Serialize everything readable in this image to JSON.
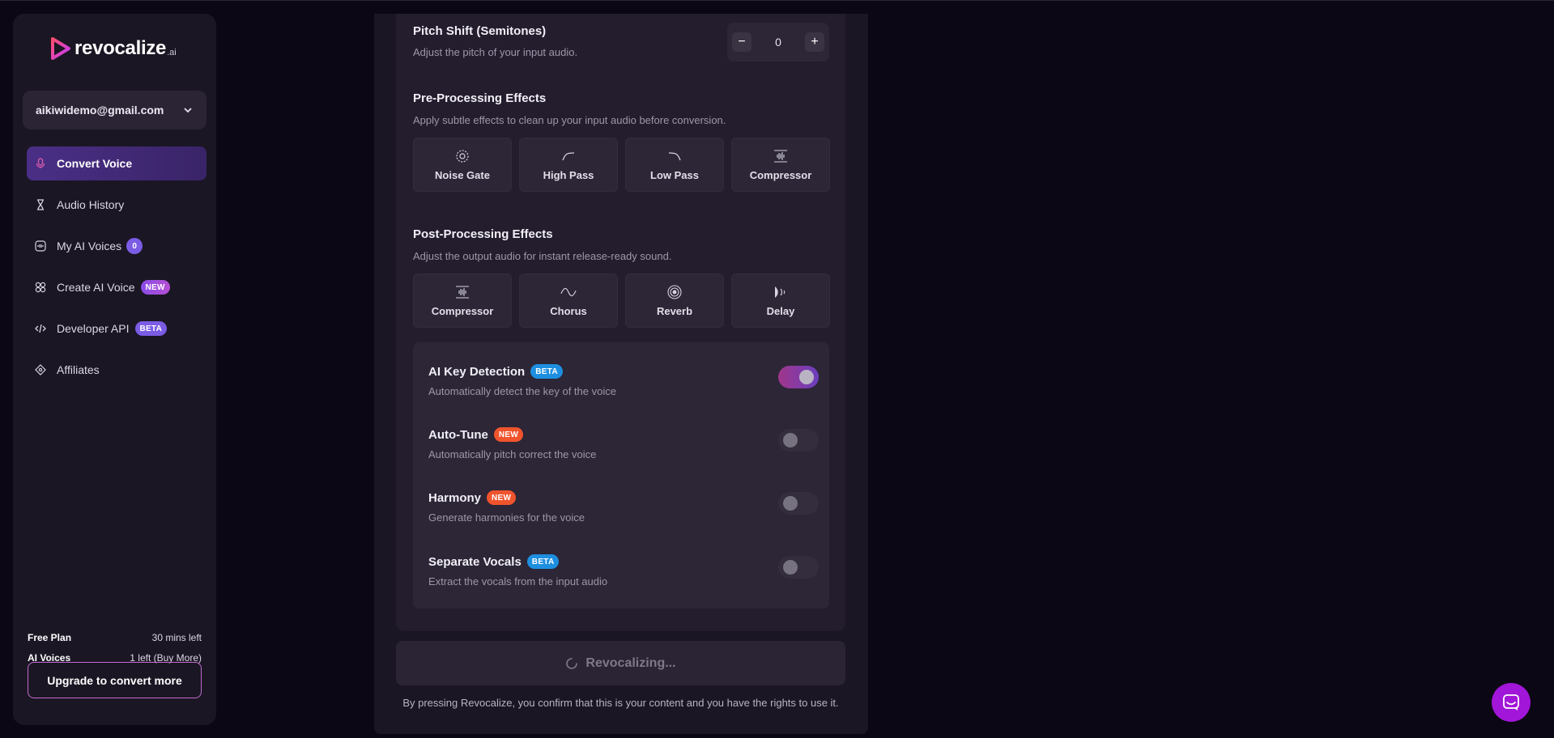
{
  "sidebar": {
    "brand": "revocalize",
    "brand_suffix": ".ai",
    "account_email": "aikiwidemo@gmail.com",
    "nav": [
      {
        "label": "Convert Voice",
        "icon": "microphone-icon",
        "active": true
      },
      {
        "label": "Audio History",
        "icon": "hourglass-icon"
      },
      {
        "label": "My AI Voices",
        "icon": "voices-icon",
        "count": "0"
      },
      {
        "label": "Create AI Voice",
        "icon": "create-voice-icon",
        "badge": "NEW"
      },
      {
        "label": "Developer API",
        "icon": "code-icon",
        "badge": "BETA"
      },
      {
        "label": "Affiliates",
        "icon": "affiliates-icon"
      }
    ],
    "plan": {
      "free_plan_label": "Free Plan",
      "free_plan_value": "30 mins left",
      "ai_voices_label": "AI Voices",
      "ai_voices_value": "1 left (Buy More)"
    },
    "upgrade_label": "Upgrade to convert more"
  },
  "pitch": {
    "title": "Pitch Shift (Semitones)",
    "subtitle": "Adjust the pitch of your input audio.",
    "value": "0",
    "minus": "−",
    "plus": "+"
  },
  "pre": {
    "title": "Pre-Processing Effects",
    "subtitle": "Apply subtle effects to clean up your input audio before conversion.",
    "effects": [
      "Noise Gate",
      "High Pass",
      "Low Pass",
      "Compressor"
    ]
  },
  "post": {
    "title": "Post-Processing Effects",
    "subtitle": "Adjust the output audio for instant release-ready sound.",
    "effects": [
      "Compressor",
      "Chorus",
      "Reverb",
      "Delay"
    ]
  },
  "toggles": [
    {
      "title": "AI Key Detection",
      "badge": "BETA",
      "desc": "Automatically detect the key of the voice",
      "on": true
    },
    {
      "title": "Auto-Tune",
      "badge": "NEW",
      "desc": "Automatically pitch correct the voice",
      "on": false
    },
    {
      "title": "Harmony",
      "badge": "NEW",
      "desc": "Generate harmonies for the voice",
      "on": false
    },
    {
      "title": "Separate Vocals",
      "badge": "BETA",
      "desc": "Extract the vocals from the input audio",
      "on": false
    }
  ],
  "convert_label": "Revocalizing...",
  "disclaimer": "By pressing Revocalize, you confirm that this is your content and you have the rights to use it.",
  "colors": {
    "accent": "#7b5ce5",
    "badge_new": "#f0542d",
    "badge_beta": "#1e8fe0",
    "chat": "#a116d8"
  }
}
